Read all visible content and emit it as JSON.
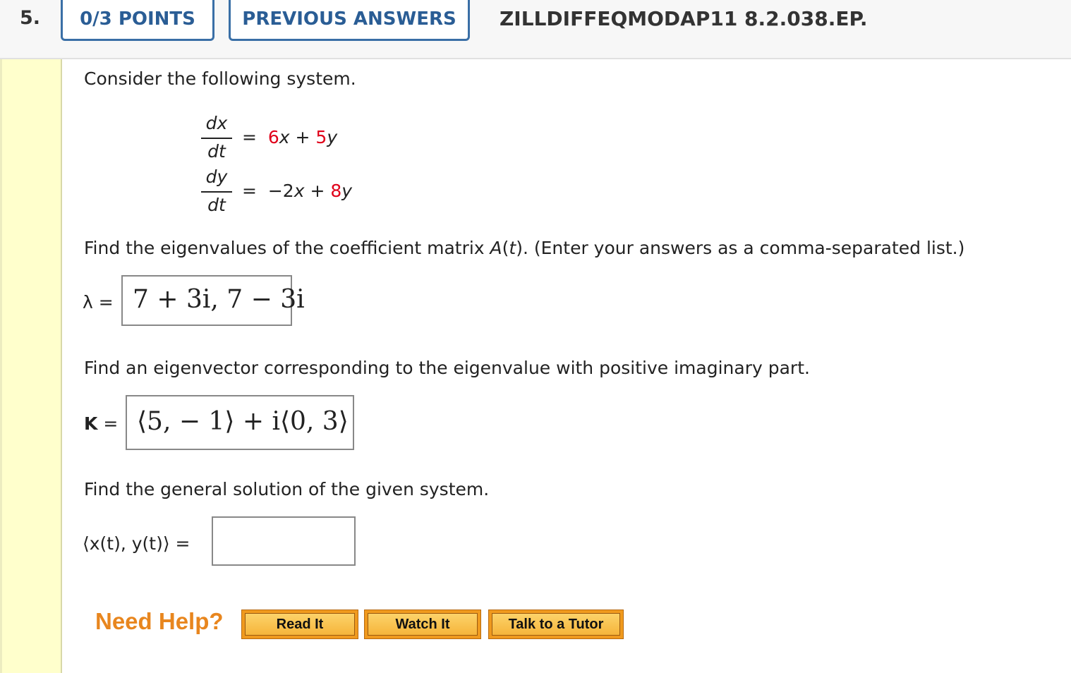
{
  "header": {
    "question_number": "5.",
    "points_label": "0/3 POINTS",
    "previous_answers_label": "PREVIOUS ANSWERS",
    "question_id": "ZILLDIFFEQMODAP11 8.2.038.EP."
  },
  "problem": {
    "intro": "Consider the following system.",
    "eq1": {
      "num": "dx",
      "den": "dt",
      "equals": "=",
      "c1": "6",
      "v1": "x",
      "op": "+",
      "c2": "5",
      "v2": "y"
    },
    "eq2": {
      "num": "dy",
      "den": "dt",
      "equals": "=",
      "c1": "−2",
      "v1": "x",
      "op": "+",
      "c2": "8",
      "v2": "y"
    },
    "part1": {
      "prompt_before": "Find the eigenvalues of the coefficient matrix ",
      "matrix": "A",
      "paren_open": "(",
      "var": "t",
      "prompt_after": "). (Enter your answers as a comma-separated list.)",
      "label": "λ =",
      "answer": "7 + 3i, 7 − 3i"
    },
    "part2": {
      "prompt": "Find an eigenvector corresponding to the eigenvalue with positive imaginary part.",
      "label": "K",
      "equals": "=",
      "answer": "⟨5, − 1⟩ + i⟨0, 3⟩"
    },
    "part3": {
      "prompt": "Find the general solution of the given system.",
      "label": "⟨x(t), y(t)⟩ =",
      "answer": ""
    }
  },
  "help": {
    "label": "Need Help?",
    "buttons": [
      "Read It",
      "Watch It",
      "Talk to a Tutor"
    ]
  }
}
